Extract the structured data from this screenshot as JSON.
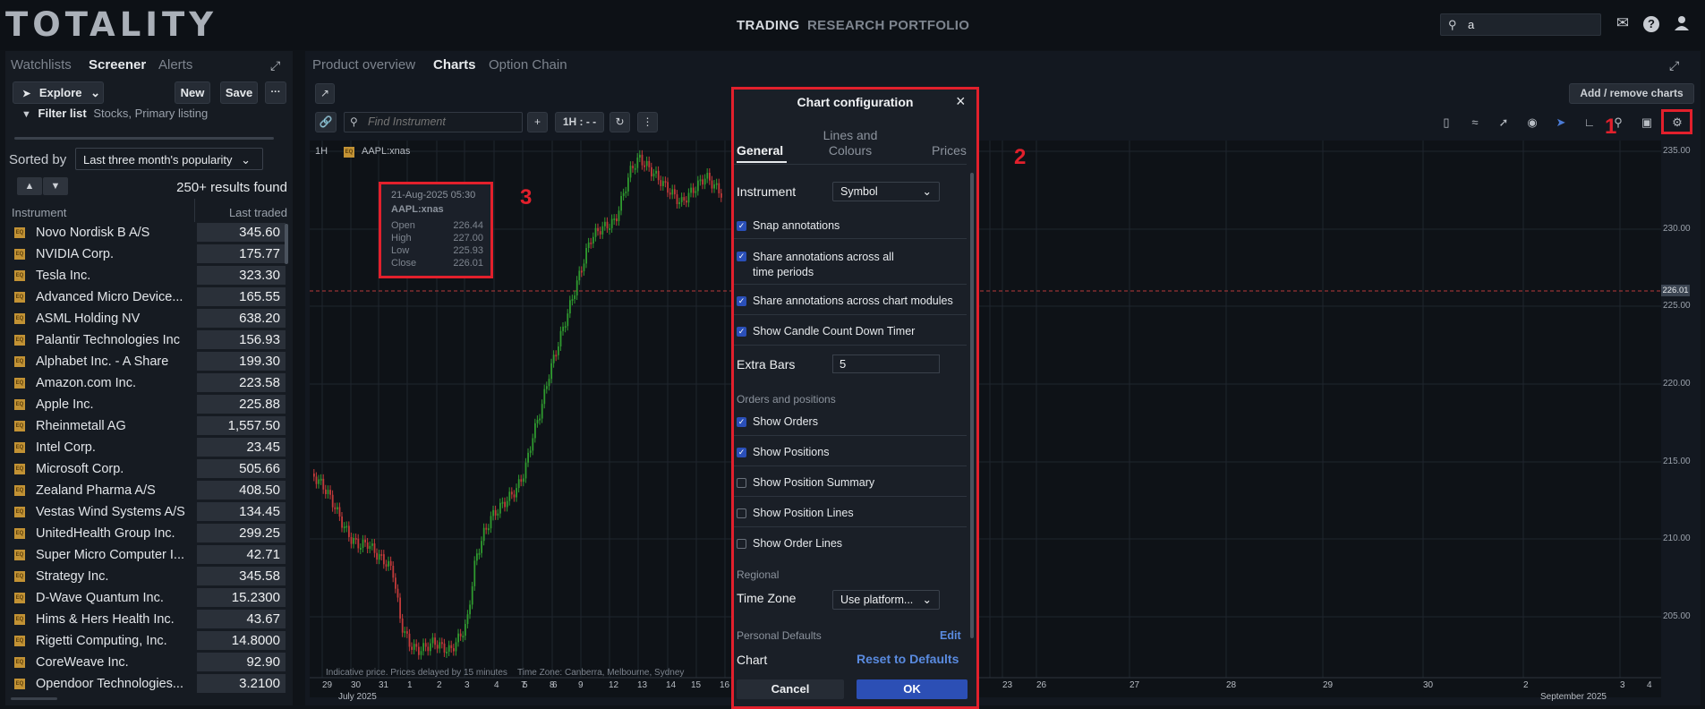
{
  "app": {
    "logo": "TOTALITY",
    "nav": [
      "TRADING",
      "RESEARCH",
      "PORTFOLIO"
    ],
    "search_value": "a",
    "icons": [
      "mail-icon",
      "help-icon",
      "user-icon"
    ]
  },
  "left_panel": {
    "tabs": [
      "Watchlists",
      "Screener",
      "Alerts"
    ],
    "active_tab": "Screener",
    "explore_label": "Explore",
    "new_label": "New",
    "save_label": "Save",
    "more_label": "···",
    "filter_label": "Filter list",
    "filter_value": "Stocks, Primary listing",
    "sorted_by_label": "Sorted by",
    "sorted_by_value": "Last three month's popularity",
    "results_text": "250+ results found",
    "columns": [
      "Instrument",
      "Last traded"
    ],
    "rows": [
      {
        "name": "Novo Nordisk B A/S",
        "price": "345.60"
      },
      {
        "name": "NVIDIA Corp.",
        "price": "175.77"
      },
      {
        "name": "Tesla Inc.",
        "price": "323.30"
      },
      {
        "name": "Advanced Micro Device...",
        "price": "165.55"
      },
      {
        "name": "ASML Holding NV",
        "price": "638.20"
      },
      {
        "name": "Palantir Technologies Inc",
        "price": "156.93"
      },
      {
        "name": "Alphabet Inc. - A Share",
        "price": "199.30"
      },
      {
        "name": "Amazon.com Inc.",
        "price": "223.58"
      },
      {
        "name": "Apple Inc.",
        "price": "225.88"
      },
      {
        "name": "Rheinmetall AG",
        "price": "1,557.50"
      },
      {
        "name": "Intel Corp.",
        "price": "23.45"
      },
      {
        "name": "Microsoft Corp.",
        "price": "505.66"
      },
      {
        "name": "Zealand Pharma A/S",
        "price": "408.50"
      },
      {
        "name": "Vestas Wind Systems A/S",
        "price": "134.45"
      },
      {
        "name": "UnitedHealth Group Inc.",
        "price": "299.25"
      },
      {
        "name": "Super Micro Computer I...",
        "price": "42.71"
      },
      {
        "name": "Strategy Inc.",
        "price": "345.58"
      },
      {
        "name": "D-Wave Quantum Inc.",
        "price": "15.2300"
      },
      {
        "name": "Hims & Hers Health Inc.",
        "price": "43.67"
      },
      {
        "name": "Rigetti Computing, Inc.",
        "price": "14.8000"
      },
      {
        "name": "CoreWeave Inc.",
        "price": "92.90"
      },
      {
        "name": "Opendoor Technologies...",
        "price": "3.2100"
      }
    ]
  },
  "main": {
    "tabs": [
      "Product overview",
      "Charts",
      "Option Chain"
    ],
    "active_tab": "Charts",
    "add_remove_label": "Add / remove charts",
    "find_placeholder": "Find Instrument",
    "interval_label": "1H : - -",
    "chart_interval": "1H",
    "chart_symbol": "AAPL:xnas",
    "current_price_label": "226.01",
    "footer_note": "Indicative price. Prices delayed by 15 minutes",
    "timezone_note": "Time Zone: Canberra, Melbourne, Sydney",
    "y_ticks": [
      "235.00",
      "230.00",
      "225.00",
      "220.00",
      "215.00",
      "210.00",
      "205.00"
    ],
    "x_ticks": [
      "29",
      "30",
      "31",
      "1",
      "2",
      "3",
      "4",
      "5",
      "6",
      "7",
      "8",
      "9",
      "12",
      "13",
      "14",
      "15",
      "16",
      "23",
      "26",
      "27",
      "28",
      "29",
      "30",
      "2",
      "3",
      "4"
    ],
    "month_labels": [
      "July 2025",
      "September 2025"
    ]
  },
  "tooltip": {
    "date": "21-Aug-2025 05:30",
    "symbol": "AAPL:xnas",
    "rows": [
      {
        "label": "Open",
        "value": "226.44"
      },
      {
        "label": "High",
        "value": "227.00"
      },
      {
        "label": "Low",
        "value": "225.93"
      },
      {
        "label": "Close",
        "value": "226.01"
      }
    ]
  },
  "dialog": {
    "title": "Chart configuration",
    "tabs": [
      "General",
      "Lines and Colours",
      "Prices"
    ],
    "active_tab": "General",
    "instrument_label": "Instrument",
    "instrument_value": "Symbol",
    "checks": [
      {
        "label": "Snap annotations",
        "checked": true
      },
      {
        "label": "Share annotations across all time periods",
        "checked": true
      },
      {
        "label": "Share annotations across chart modules",
        "checked": true
      },
      {
        "label": "Show Candle Count Down Timer",
        "checked": true
      }
    ],
    "extra_bars_label": "Extra Bars",
    "extra_bars_value": "5",
    "orders_section": "Orders and positions",
    "order_checks": [
      {
        "label": "Show Orders",
        "checked": true
      },
      {
        "label": "Show Positions",
        "checked": true
      },
      {
        "label": "Show Position Summary",
        "checked": false
      },
      {
        "label": "Show Position Lines",
        "checked": false
      },
      {
        "label": "Show Order Lines",
        "checked": false
      }
    ],
    "regional_section": "Regional",
    "timezone_label": "Time Zone",
    "timezone_value": "Use platform...",
    "personal_defaults_label": "Personal Defaults",
    "edit_label": "Edit",
    "chart_label": "Chart",
    "reset_label": "Reset to Defaults",
    "cancel_label": "Cancel",
    "ok_label": "OK"
  },
  "annotations": [
    "1",
    "2",
    "3"
  ],
  "colors": {
    "accent_red": "#e2202c",
    "ok_blue": "#2c4fb5",
    "candle_up": "#2f9a2f",
    "candle_down": "#c23a3a"
  }
}
